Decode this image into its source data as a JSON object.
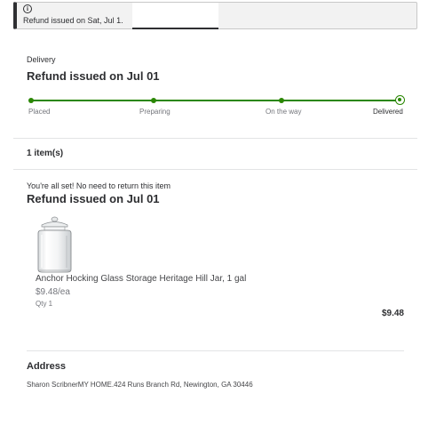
{
  "banner": {
    "icon": "info-icon",
    "message": "Refund issued on Sat, Jul 1."
  },
  "order": {
    "type_label": "Delivery",
    "status_title": "Refund issued on Jul 01",
    "progress": {
      "steps": [
        "Placed",
        "Preparing",
        "On the way",
        "Delivered"
      ],
      "current_step": "Delivered",
      "color": "#2a8703"
    }
  },
  "items": {
    "count_label": "1 item(s)",
    "return_note": "You're all set! No need to return this item",
    "refund_title": "Refund issued on Jul 01",
    "list": [
      {
        "name": "Anchor Hocking Glass Storage Heritage Hill Jar, 1 gal",
        "unit_price": "$9.48/ea",
        "qty": "Qty 1",
        "total": "$9.48"
      }
    ]
  },
  "address": {
    "title": "Address",
    "text": "Sharon ScribnerMY HOME.424 Runs Branch Rd, Newington, GA 30446"
  }
}
